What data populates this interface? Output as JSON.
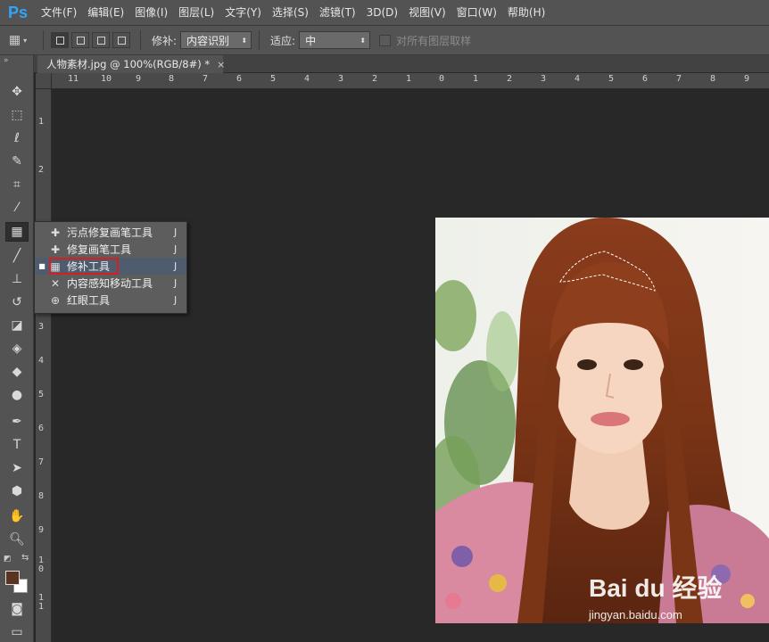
{
  "app": {
    "logo": "Ps",
    "accent": "#33a3f5"
  },
  "menu": [
    "文件(F)",
    "编辑(E)",
    "图像(I)",
    "图层(L)",
    "文字(Y)",
    "选择(S)",
    "滤镜(T)",
    "3D(D)",
    "视图(V)",
    "窗口(W)",
    "帮助(H)"
  ],
  "options": {
    "patch_label": "修补:",
    "patch_value": "内容识别",
    "adapt_label": "适应:",
    "adapt_value": "中",
    "sample_all_label": "对所有图层取样"
  },
  "document": {
    "tab_title": "人物素材.jpg @ 100%(RGB/8#) *",
    "close": "×"
  },
  "ruler_top": [
    "11",
    "10",
    "9",
    "8",
    "7",
    "6",
    "5",
    "4",
    "3",
    "2",
    "1",
    "0",
    "1",
    "2",
    "3",
    "4",
    "5",
    "6",
    "7",
    "8",
    "9"
  ],
  "ruler_left": [
    "1",
    "2",
    "3",
    "4",
    "5",
    "6",
    "7",
    "8",
    "9",
    "1\n0",
    "1\n1"
  ],
  "flyout": {
    "items": [
      {
        "label": "污点修复画笔工具",
        "key": "J",
        "icon": "spot-healing-icon"
      },
      {
        "label": "修复画笔工具",
        "key": "J",
        "icon": "healing-brush-icon"
      },
      {
        "label": "修补工具",
        "key": "J",
        "icon": "patch-icon",
        "selected": true
      },
      {
        "label": "内容感知移动工具",
        "key": "J",
        "icon": "content-aware-move-icon"
      },
      {
        "label": "红眼工具",
        "key": "J",
        "icon": "red-eye-icon"
      }
    ]
  },
  "colors": {
    "foreground": "#5b3322",
    "background": "#ffffff"
  },
  "watermark": {
    "brand": "Bai du 经验",
    "url": "jingyan.baidu.com"
  }
}
